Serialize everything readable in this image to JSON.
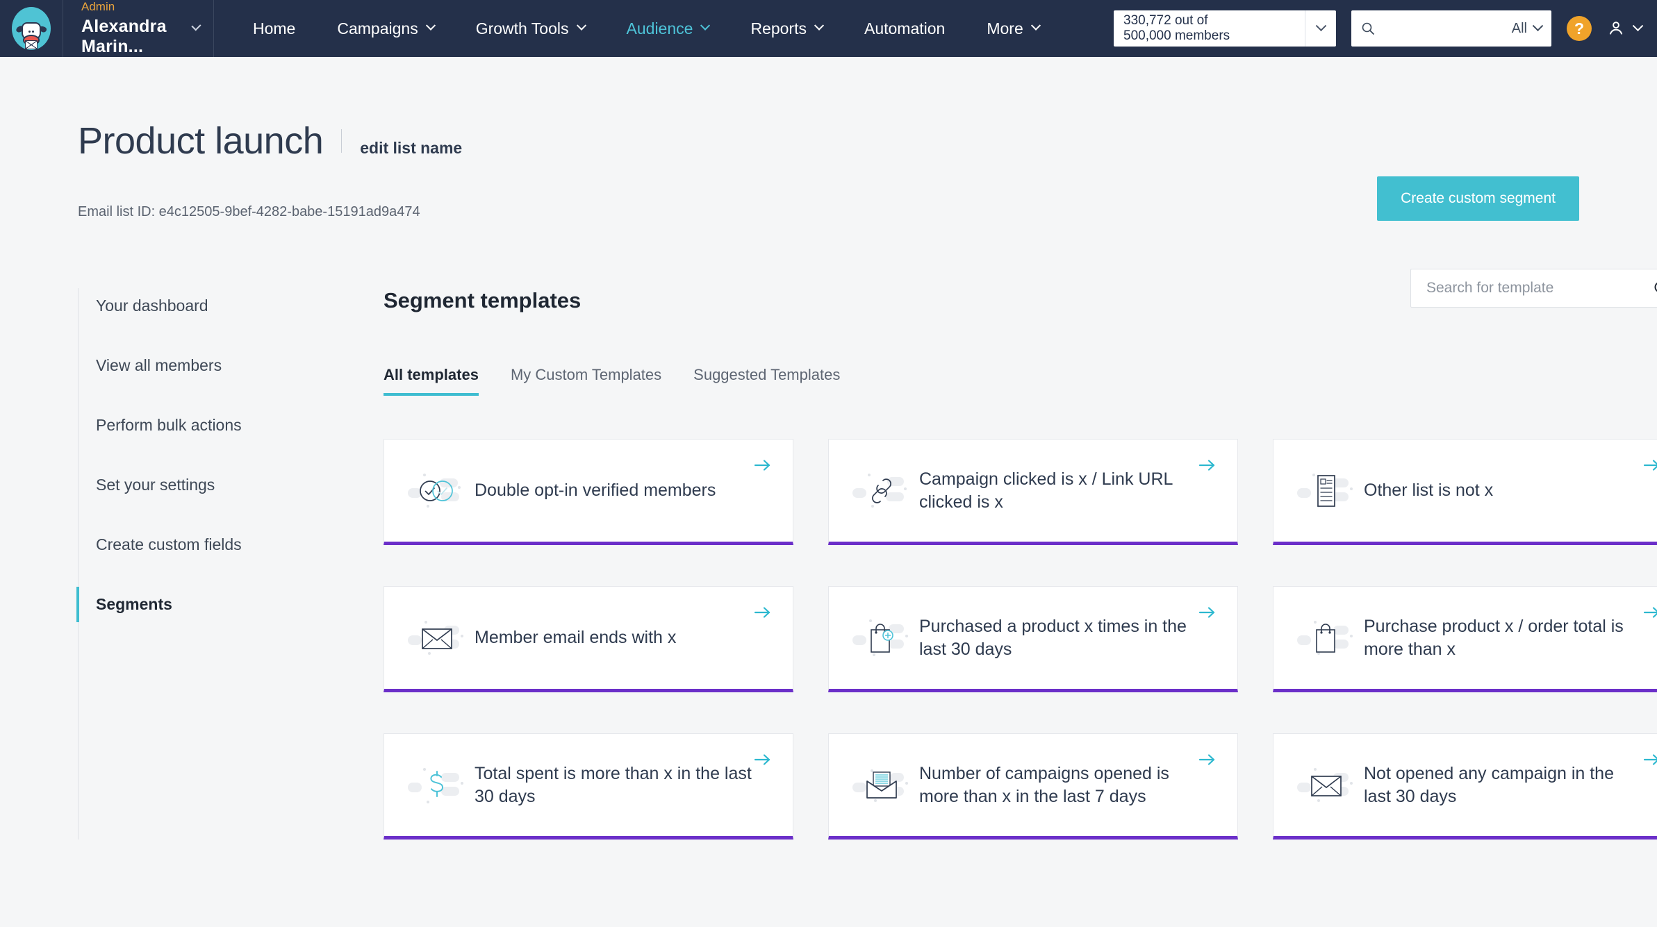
{
  "topnav": {
    "logo_alt": "moosend-cow-logo",
    "account": {
      "role": "Admin",
      "name": "Alexandra Marin..."
    },
    "links": [
      {
        "label": "Home",
        "has_caret": false,
        "active": false
      },
      {
        "label": "Campaigns",
        "has_caret": true,
        "active": false
      },
      {
        "label": "Growth Tools",
        "has_caret": true,
        "active": false
      },
      {
        "label": "Audience",
        "has_caret": true,
        "active": true
      },
      {
        "label": "Reports",
        "has_caret": true,
        "active": false
      },
      {
        "label": "Automation",
        "has_caret": false,
        "active": false
      },
      {
        "label": "More",
        "has_caret": true,
        "active": false
      }
    ],
    "members_quota": {
      "line1": "330,772 out of",
      "line2": "500,000 members"
    },
    "search": {
      "value": "",
      "placeholder": "",
      "scope": "All"
    },
    "help_label": "?"
  },
  "page": {
    "title": "Product launch",
    "edit_link": "edit list name",
    "list_id": "Email list ID: e4c12505-9bef-4282-babe-15191ad9a474",
    "create_segment_button": "Create custom segment"
  },
  "sidebar": {
    "items": [
      {
        "label": "Your dashboard",
        "active": false
      },
      {
        "label": "View all members",
        "active": false
      },
      {
        "label": "Perform bulk actions",
        "active": false
      },
      {
        "label": "Set your settings",
        "active": false
      },
      {
        "label": "Create custom fields",
        "active": false
      },
      {
        "label": "Segments",
        "active": true
      }
    ]
  },
  "main": {
    "section_title": "Segment templates",
    "template_search": {
      "value": "",
      "placeholder": "Search for template"
    },
    "tabs": [
      {
        "label": "All templates",
        "active": true
      },
      {
        "label": "My Custom Templates",
        "active": false
      },
      {
        "label": "Suggested Templates",
        "active": false
      }
    ],
    "cards": [
      {
        "label": "Double opt-in verified members",
        "icon": "double-check-circles-icon"
      },
      {
        "label": "Campaign clicked is x / Link URL clicked is x",
        "icon": "link-chain-icon"
      },
      {
        "label": "Other list is not x",
        "icon": "list-document-icon"
      },
      {
        "label": "Member email ends with x",
        "icon": "envelope-icon"
      },
      {
        "label": "Purchased a product x times in the last 30 days",
        "icon": "shopping-bag-plus-icon"
      },
      {
        "label": "Purchase product x / order total is more than x",
        "icon": "shopping-bag-icon"
      },
      {
        "label": "Total spent is more than x in the last 30 days",
        "icon": "dollar-sign-icon"
      },
      {
        "label": "Number of campaigns opened is more than x in the last 7 days",
        "icon": "open-envelope-icon"
      },
      {
        "label": "Not opened any campaign in the last 30 days",
        "icon": "envelope-icon"
      }
    ]
  },
  "colors": {
    "nav_bg": "#24304a",
    "accent_teal": "#42bfd0",
    "card_underline_purple": "#6b2fc9",
    "help_orange": "#f0a32a",
    "role_amber": "#e8a33d"
  }
}
